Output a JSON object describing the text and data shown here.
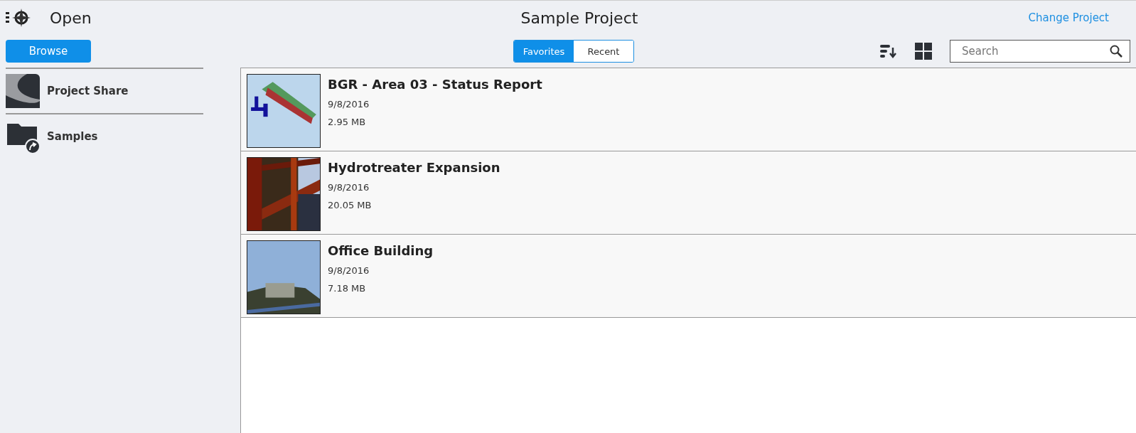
{
  "header": {
    "title": "Open",
    "project": "Sample Project",
    "change_link": "Change Project"
  },
  "browse_button": "Browse",
  "sidebar": {
    "items": [
      {
        "label": "Project Share",
        "kind": "share"
      },
      {
        "label": "Samples",
        "kind": "folder"
      }
    ]
  },
  "tabs": [
    {
      "label": "Favorites",
      "selected": true
    },
    {
      "label": "Recent",
      "selected": false
    }
  ],
  "search": {
    "placeholder": "Search"
  },
  "files": [
    {
      "name": "BGR - Area 03 - Status Report",
      "date": "9/8/2016",
      "size": "2.95 MB",
      "kind": "picture"
    },
    {
      "name": "Hydrotreater Expansion",
      "date": "9/8/2016",
      "size": "20.05 MB",
      "kind": "picture"
    },
    {
      "name": "Office Building",
      "date": "9/8/2016",
      "size": "7.18 MB",
      "kind": "picture"
    }
  ]
}
